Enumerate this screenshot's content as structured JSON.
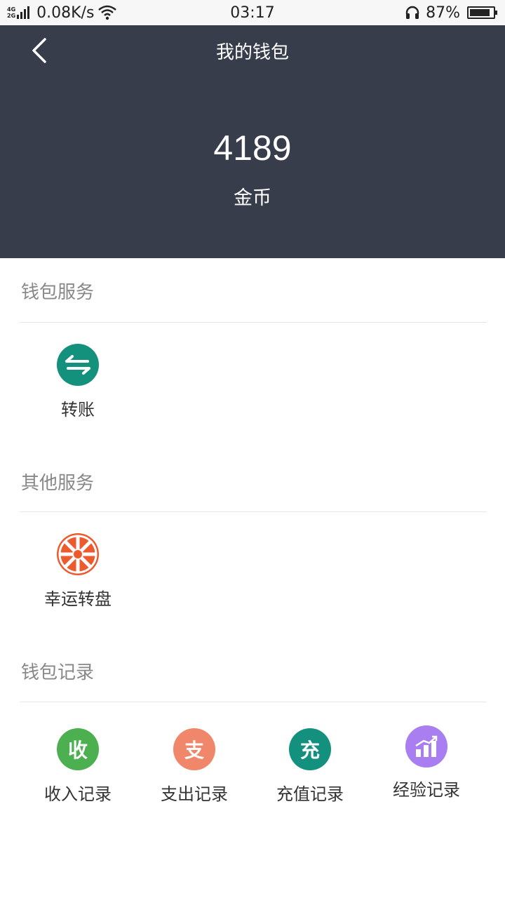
{
  "status_bar": {
    "net_top": "4G",
    "net_bottom": "2G",
    "speed": "0.08K/s",
    "time": "03:17",
    "battery_pct": "87%",
    "battery_level": 0.87
  },
  "header": {
    "title": "我的钱包",
    "balance": "4189",
    "unit": "金币",
    "bg_color": "#383d4c"
  },
  "wallet_services": {
    "title": "钱包服务",
    "items": [
      {
        "label": "转账",
        "icon": "transfer-arrows-icon",
        "color": "#14917d"
      }
    ]
  },
  "other_services": {
    "title": "其他服务",
    "items": [
      {
        "label": "幸运转盘",
        "icon": "lucky-wheel-icon",
        "color": "#ec5a2e"
      }
    ]
  },
  "wallet_records": {
    "title": "钱包记录",
    "items": [
      {
        "label": "收入记录",
        "glyph": "收",
        "icon": "income-icon",
        "color": "#4caf50"
      },
      {
        "label": "支出记录",
        "glyph": "支",
        "icon": "expense-icon",
        "color": "#f0866a"
      },
      {
        "label": "充值记录",
        "glyph": "充",
        "icon": "recharge-icon",
        "color": "#13917e"
      },
      {
        "label": "经验记录",
        "icon": "chart-icon",
        "color": "#a97ef0"
      }
    ]
  }
}
